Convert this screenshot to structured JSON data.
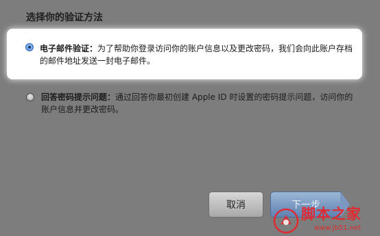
{
  "title": "选择你的验证方法",
  "options": [
    {
      "label": "电子邮件验证：",
      "description": "为了帮助你登录访问你的账户信息以及更改密码，我们会向此账户存档的邮件地址发送一封电子邮件。",
      "selected": true
    },
    {
      "label": "回答密码提示问题：",
      "description": "通过回答你最初创建 Apple ID 时设置的密码提示问题，访问你的账户信息并更改密码。",
      "selected": false
    }
  ],
  "buttons": {
    "cancel": "取消",
    "next": "下一步"
  },
  "watermark": {
    "text": "脚本之家",
    "url": "www.jb51.net",
    "color": "#e8232a"
  },
  "colors": {
    "background": "#7d7d7d",
    "card": "#ffffff",
    "accent": "#3d6fbf"
  }
}
